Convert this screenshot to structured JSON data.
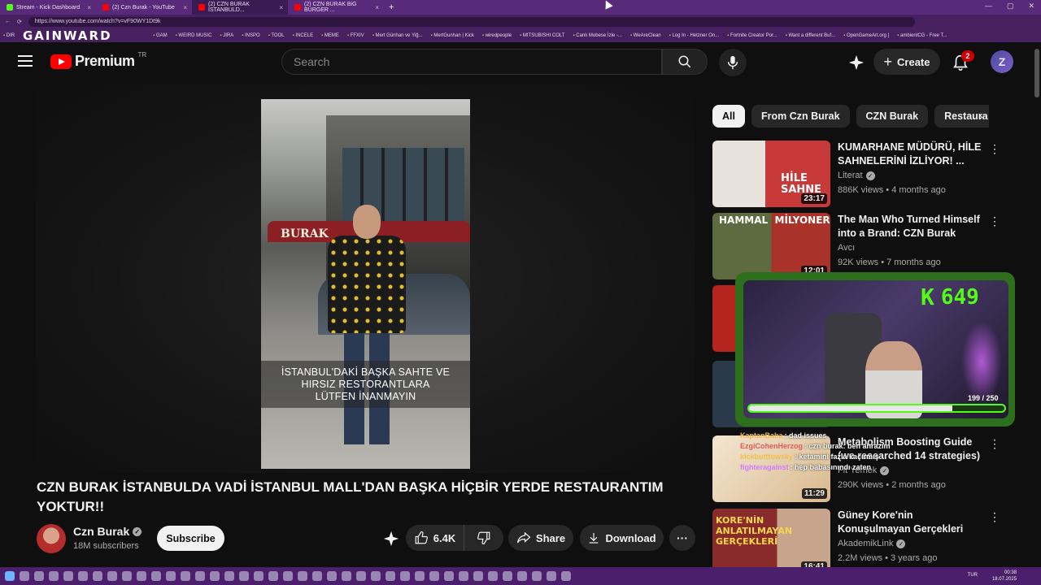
{
  "browser": {
    "tabs": [
      {
        "label": "Stream - Kick Dashboard",
        "color": "#53fc18"
      },
      {
        "label": "(2) Czn Burak - YouTube",
        "color": "#ff0000"
      },
      {
        "label": "(2) CZN BURAK İSTANBULD...",
        "color": "#ff0000"
      },
      {
        "label": "(2) CZN BURAK BiG BURGER ...",
        "color": "#ff0000"
      }
    ],
    "url": "https://www.youtube.com/watch?v=vF90WY1Dt9k",
    "bookmarks": [
      "DIR",
      "GAM",
      "WEIRD MUSIC",
      "JIRA",
      "INSPO",
      "TOOL",
      "INCELE",
      "MEME",
      "FFXIV",
      "Mert Günhan ve Yiğ...",
      "MertGunhan | Kick",
      "wiredpeople",
      "MITSUBISHI COLT",
      "Canlı Mobese İzle -...",
      "WeAreClean",
      "Log In - Hetzner On...",
      "Fortnite Creator Por...",
      "Want a different Buf...",
      "OpenGameArt.org |",
      "ambientCG - Free T..."
    ]
  },
  "overlay_brand": "GAINWARD",
  "header": {
    "logo_text": "Premium",
    "logo_region": "TR",
    "search_placeholder": "Search",
    "create_label": "Create",
    "notification_count": "2",
    "avatar_letter": "Z"
  },
  "video": {
    "caption_lines": [
      "İSTANBUL'DAKİ BAŞKA SAHTE VE",
      "HIRSIZ RESTORANTLARA",
      "LÜTFEN İNANMAYIN"
    ],
    "sign_text": "BURAK",
    "title": "CZN BURAK İSTANBULDA VADİ İSTANBUL MALL'DAN BAŞKA HİÇBİR YERDE RESTAURANTIM YOKTUR!!",
    "channel_name": "Czn Burak",
    "subscribers": "18M subscribers",
    "subscribe_label": "Subscribe",
    "likes": "6.4K",
    "share_label": "Share",
    "download_label": "Download"
  },
  "chips": [
    "All",
    "From Czn Burak",
    "CZN Burak",
    "Restaura"
  ],
  "recommendations": [
    {
      "title": "KUMARHANE MÜDÜRÜ, HİLE SAHNELERİNİ İZLİYOR! ...",
      "channel": "Literat",
      "verified": true,
      "meta": "886K views • 4 months ago",
      "duration": "23:17",
      "thumb_text": "HİLE SAHNE"
    },
    {
      "title": "The Man Who Turned Himself into a Brand: CZN Burak",
      "channel": "Avcı",
      "verified": false,
      "meta": "92K views • 7 months ago",
      "duration": "12:01",
      "thumb_text": "HAMMAL  MİLYONER"
    },
    {
      "title": "Metabolism Boosting Guide (we researched 14 strategies)",
      "channel": "Fit Yemek",
      "verified": true,
      "meta": "290K views • 2 months ago",
      "duration": "11:29",
      "thumb_text": ""
    },
    {
      "title": "Güney Kore'nin Konuşulmayan Gerçekleri",
      "channel": "AkademikLink",
      "verified": true,
      "meta": "2.2M views • 3 years ago",
      "duration": "16:41",
      "thumb_text": "KORE'NİN ANLATILMAYAN GERÇEKLERİ"
    }
  ],
  "stream_overlay": {
    "kick_count": "649",
    "progress_label": "199 / 250",
    "progress_fraction": 0.796
  },
  "chat": [
    {
      "user": "KaptanBaba",
      "message": ": dad issues"
    },
    {
      "user": "EzgiCohenHerzog",
      "message": ": czn burak: ben ahrazım"
    },
    {
      "user": "kickbutttowsky",
      "message": ": ketamini fazla kaçırmış"
    },
    {
      "user": "fighteragainst",
      "message": ": hep babasınındı zaten"
    }
  ],
  "system": {
    "language": "TUR",
    "time": "00:38",
    "date": "18.07.2025"
  }
}
